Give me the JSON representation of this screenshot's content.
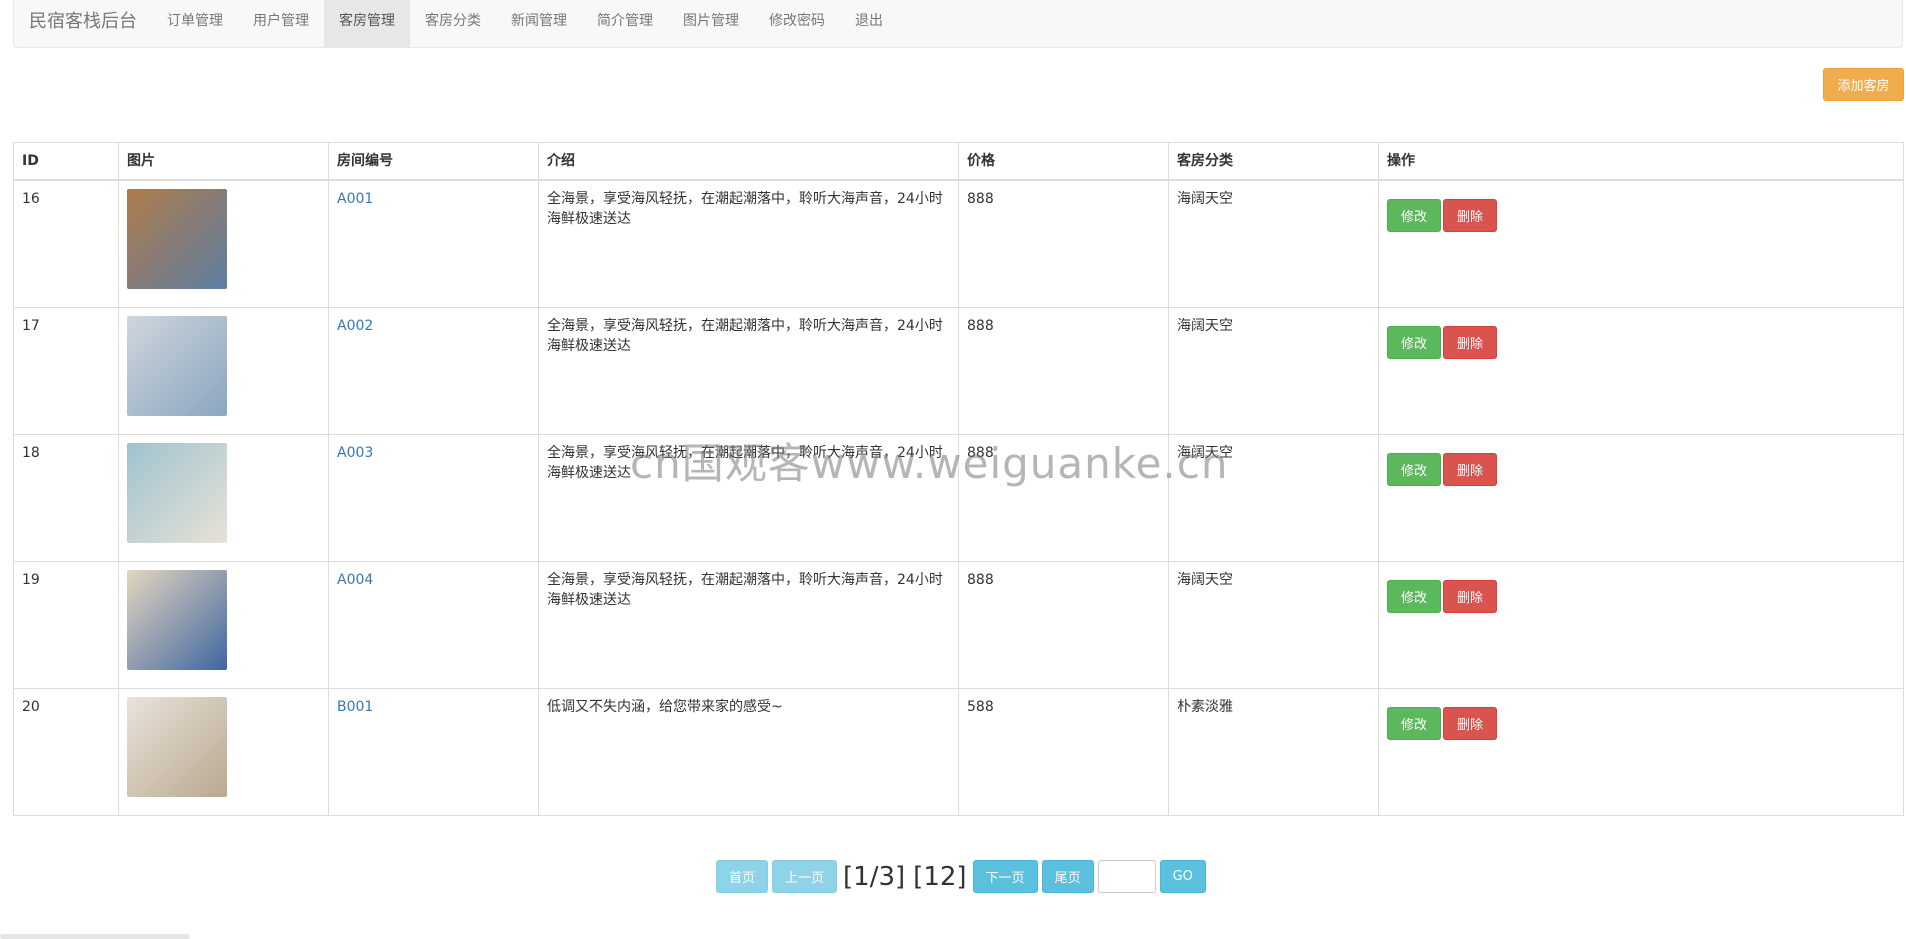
{
  "nav": {
    "brand": "民宿客栈后台",
    "items": [
      {
        "label": "订单管理"
      },
      {
        "label": "用户管理"
      },
      {
        "label": "客房管理",
        "active": true
      },
      {
        "label": "客房分类"
      },
      {
        "label": "新闻管理"
      },
      {
        "label": "简介管理"
      },
      {
        "label": "图片管理"
      },
      {
        "label": "修改密码"
      },
      {
        "label": "退出"
      }
    ]
  },
  "toolbar": {
    "add_label": "添加客房"
  },
  "table": {
    "headers": [
      "ID",
      "图片",
      "房间编号",
      "介绍",
      "价格",
      "客房分类",
      "操作"
    ],
    "rows": [
      {
        "id": "16",
        "no": "A001",
        "intro": "全海景，享受海风轻抚，在潮起潮落中，聆听大海声音，24小时海鲜极速送达",
        "price": "888",
        "category": "海阔天空",
        "img_color": [
          "#b07a4a",
          "#5d7fa3"
        ]
      },
      {
        "id": "17",
        "no": "A002",
        "intro": "全海景，享受海风轻抚，在潮起潮落中，聆听大海声音，24小时海鲜极速送达",
        "price": "888",
        "category": "海阔天空",
        "img_color": [
          "#cfd6dc",
          "#8aa6c0"
        ]
      },
      {
        "id": "18",
        "no": "A003",
        "intro": "全海景，享受海风轻抚，在潮起潮落中，聆听大海声音，24小时海鲜极速送达",
        "price": "888",
        "category": "海阔天空",
        "img_color": [
          "#9ec3d0",
          "#e8e2d6"
        ]
      },
      {
        "id": "19",
        "no": "A004",
        "intro": "全海景，享受海风轻抚，在潮起潮落中，聆听大海声音，24小时海鲜极速送达",
        "price": "888",
        "category": "海阔天空",
        "img_color": [
          "#e4d6bf",
          "#3f66a0"
        ]
      },
      {
        "id": "20",
        "no": "B001",
        "intro": "低调又不失内涵，给您带来家的感受~",
        "price": "588",
        "category": "朴素淡雅",
        "img_color": [
          "#e9e3da",
          "#b9a98f"
        ]
      }
    ],
    "edit_label": "修改",
    "delete_label": "删除"
  },
  "pager": {
    "first": "首页",
    "prev": "上一页",
    "page_info": "[1/3]",
    "total_info": "[12]",
    "next": "下一页",
    "last": "尾页",
    "go": "GO"
  },
  "watermark": "cn国观客www.weiguanke.cn"
}
